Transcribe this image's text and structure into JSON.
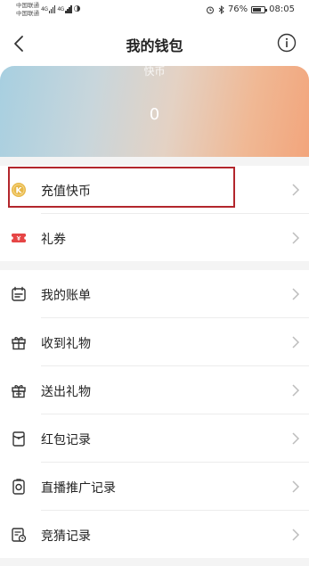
{
  "status_bar": {
    "carrier1": "中国联通",
    "carrier2": "中国联通",
    "net1": "4G",
    "net2": "4G",
    "battery": "76%",
    "battery_level": 0.76,
    "time": "08:05"
  },
  "navbar": {
    "title": "我的钱包",
    "back_icon": "chevron-left-icon",
    "info_icon": "info-circle-icon"
  },
  "balance": {
    "label": "快币",
    "value": "0"
  },
  "group1": [
    {
      "label": "充值快币",
      "icon": "coin-icon"
    },
    {
      "label": "礼券",
      "icon": "coupon-icon"
    }
  ],
  "group2": [
    {
      "label": "我的账单",
      "icon": "calendar-bill-icon"
    },
    {
      "label": "收到礼物",
      "icon": "gift-received-icon"
    },
    {
      "label": "送出礼物",
      "icon": "gift-sent-icon"
    },
    {
      "label": "红包记录",
      "icon": "red-envelope-icon"
    },
    {
      "label": "直播推广记录",
      "icon": "live-promotion-icon"
    },
    {
      "label": "竞猜记录",
      "icon": "quiz-record-icon"
    }
  ],
  "colors": {
    "highlight": "#b3262c",
    "coin": "#e8b84a",
    "coupon": "#e64545",
    "icon_stroke": "#333333",
    "chevron": "#bdbdbd"
  }
}
